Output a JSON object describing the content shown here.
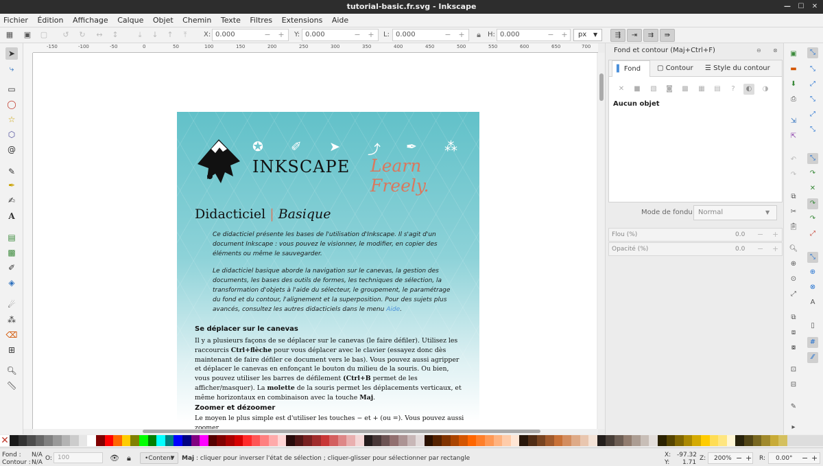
{
  "window": {
    "title": "tutorial-basic.fr.svg - Inkscape"
  },
  "menu": [
    "Fichier",
    "Édition",
    "Affichage",
    "Calque",
    "Objet",
    "Chemin",
    "Texte",
    "Filtres",
    "Extensions",
    "Aide"
  ],
  "toolbar": {
    "x_label": "X:",
    "x_value": "0.000",
    "y_label": "Y:",
    "y_value": "0.000",
    "l_label": "L:",
    "l_value": "0.000",
    "h_label": "H:",
    "h_value": "0.000",
    "unit": "px"
  },
  "ruler_ticks": [
    "-150",
    "-100",
    "-50",
    "0",
    "50",
    "100",
    "150",
    "200",
    "250",
    "300",
    "350",
    "400",
    "450",
    "500",
    "550",
    "600",
    "650",
    "700"
  ],
  "document": {
    "brand": "INKSCAPE",
    "tagline": "Learn Freely.",
    "title_main": "Didacticiel",
    "title_sep": "|",
    "title_sub": "Basique",
    "intro_p1": "Ce didacticiel présente les bases de l'utilisation d'Inkscape. Il s'agit d'un document Inkscape : vous pouvez le visionner, le modifier, en copier des éléments ou même le sauvegarder.",
    "intro_p2": "Le didacticiel basique aborde la navigation sur le canevas, la gestion des documents, les bases des outils de formes, les techniques de sélection, la transformation d'objets à l'aide du sélecteur, le groupement, le paramétrage du fond et du contour, l'alignement et la superposition. Pour des sujets plus avancés, consultez les autres didacticiels dans le menu",
    "intro_link": "Aide",
    "section1_title": "Se déplacer sur le canevas",
    "section1_a": "Il y a plusieurs façons de se déplacer sur le canevas (le faire défiler). Utilisez les raccourcis ",
    "section1_b": "Ctrl+flèche",
    "section1_c": " pour vous déplacer avec le clavier (essayez donc dès maintenant de faire défiler ce document vers le bas). Vous pouvez aussi agripper et déplacer le canevas en enfonçant le bouton du milieu de la souris. Ou bien, vous pouvez utiliser les barres de défilement ",
    "section1_d": "(Ctrl+B",
    "section1_e": " permet de les afficher/masquer). La ",
    "section1_f": "molette",
    "section1_g": " de la souris permet les déplacements verticaux, et même horizontaux en combinaison avec la touche ",
    "section1_h": "Maj",
    "section2_title": "Zoomer et dézoomer",
    "section2_text": "Le moyen le plus simple est d'utiliser les touches − et + (ou =). Vous pouvez aussi zoomer"
  },
  "fill_stroke": {
    "dock_title": "Fond et contour (Maj+Ctrl+F)",
    "tab_fill": "Fond",
    "tab_stroke": "Contour",
    "tab_stroke_style": "Style du contour",
    "no_object": "Aucun objet",
    "blend_label": "Mode de fondu :",
    "blend_value": "Normal",
    "blur_label": "Flou (%)",
    "blur_value": "0.0",
    "opacity_label": "Opacité (%)",
    "opacity_value": "0.0"
  },
  "status": {
    "fill_label": "Fond :",
    "fill_value": "N/A",
    "stroke_label": "Contour :",
    "stroke_value": "N/A",
    "o_label": "O:",
    "o_value": "100",
    "layer": "•Content",
    "message_bold": "Maj",
    "message": " : cliquer pour inverser l'état de sélection ; cliquer-glisser pour sélectionner par rectangle",
    "x_label": "X:",
    "x_value": "-97.32",
    "y_label": "Y:",
    "y_value": "1.71",
    "z_label": "Z:",
    "zoom": "200%",
    "r_label": "R:",
    "rotation": "0.00°"
  },
  "colors": {
    "palette": [
      "#1a1a1a",
      "#333333",
      "#4d4d4d",
      "#666666",
      "#808080",
      "#999999",
      "#b3b3b3",
      "#cccccc",
      "#e6e6e6",
      "#ffffff",
      "#800000",
      "#ff0000",
      "#ff6600",
      "#ffcc00",
      "#808000",
      "#00ff00",
      "#008000",
      "#00ffff",
      "#008080",
      "#0000ff",
      "#000080",
      "#800080",
      "#ff00ff",
      "#550000",
      "#800000",
      "#aa0000",
      "#d40000",
      "#ff2a2a",
      "#ff5555",
      "#ff8080",
      "#ffaaaa",
      "#ffd5d5",
      "#280b0b",
      "#501616",
      "#782121",
      "#a02c2c",
      "#c83737",
      "#d35f5f",
      "#de8787",
      "#e9afaf",
      "#f4d7d7",
      "#241c1c",
      "#483737",
      "#6c5353",
      "#916f6f",
      "#ac9393",
      "#c8b7b7",
      "#e3dbdb",
      "#2b1100",
      "#552200",
      "#803300",
      "#aa4400",
      "#d45500",
      "#ff6600",
      "#ff7f2a",
      "#ff9955",
      "#ffb380",
      "#ffccaa",
      "#ffe6d5",
      "#28170b",
      "#502d16",
      "#784421",
      "#a05a2c",
      "#c87137",
      "#d38d5f",
      "#deaa87",
      "#e9c6af",
      "#f4e3d7",
      "#241f1c",
      "#483e37",
      "#6c5d53",
      "#917c6f",
      "#ac9d93",
      "#c8beb7",
      "#e3dedb",
      "#2b2200",
      "#554400",
      "#806600",
      "#aa8800",
      "#d4aa00",
      "#ffcc00",
      "#ffdd55",
      "#ffe680",
      "#fff6d5",
      "#28220b",
      "#504416",
      "#786721",
      "#a0892c",
      "#c8ab37",
      "#d4c05f"
    ],
    "accent": "#1f6fd0",
    "tagline": "#d9785e"
  }
}
